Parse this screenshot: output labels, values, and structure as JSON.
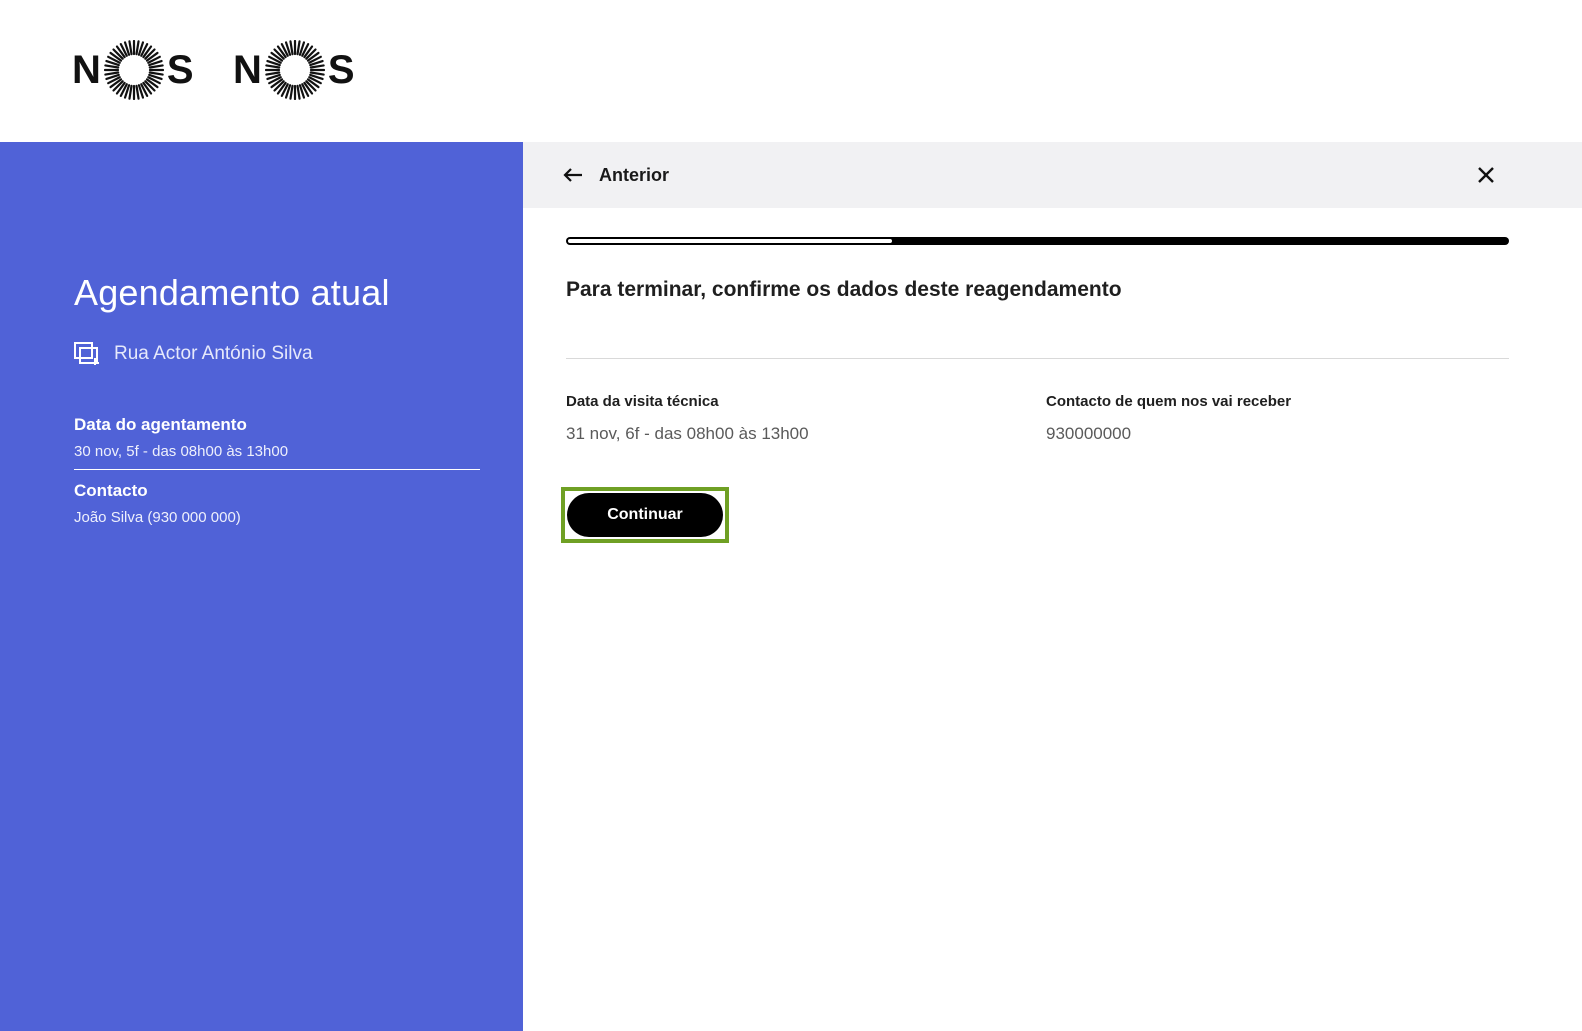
{
  "brand": {
    "logo1": {
      "left": "N",
      "right": "S"
    },
    "logo2": {
      "left": "N",
      "right": "S"
    }
  },
  "sidebar": {
    "title": "Agendamento atual",
    "address": "Rua Actor António Silva",
    "address_icon": "address-icon",
    "date_label": "Data do agentamento",
    "date_value": "30 nov, 5f - das 08h00 às 13h00",
    "contact_label": "Contacto",
    "contact_value": "João Silva (930 000 000)",
    "background_color": "#5062d7"
  },
  "topbar": {
    "back_label": "Anterior",
    "back_icon": "arrow-left-icon",
    "close_icon": "close-icon"
  },
  "progress": {
    "fraction": 0.345
  },
  "main": {
    "title": "Para terminar, confirme os dados deste reagendamento",
    "fields": [
      {
        "label": "Data da visita técnica",
        "value": "31 nov, 6f - das 08h00 às 13h00"
      },
      {
        "label": "Contacto de quem nos vai receber",
        "value": "930000000"
      }
    ],
    "continue_label": "Continuar",
    "highlight_color": "#6fa024"
  }
}
